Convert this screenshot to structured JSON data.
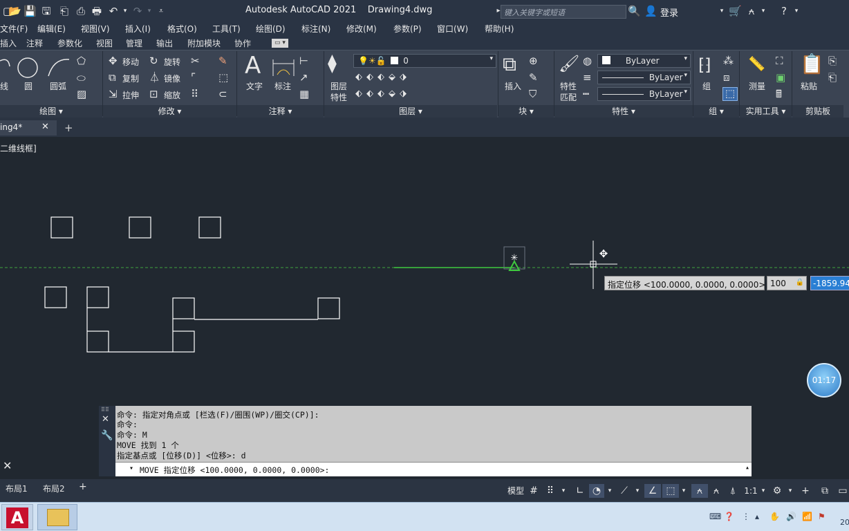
{
  "titlebar": {
    "app_title": "Autodesk AutoCAD 2021    Drawing4.dwg",
    "search_placeholder": "键入关键字或短语",
    "login": "登录"
  },
  "menu": [
    "文件(F)",
    "编辑(E)",
    "视图(V)",
    "插入(I)",
    "格式(O)",
    "工具(T)",
    "绘图(D)",
    "标注(N)",
    "修改(M)",
    "参数(P)",
    "窗口(W)",
    "帮助(H)"
  ],
  "ribbon_tabs": [
    "插入",
    "注释",
    "参数化",
    "视图",
    "管理",
    "输出",
    "附加模块",
    "协作"
  ],
  "ribbon": {
    "draw": {
      "line": "线",
      "circle": "圆",
      "arc": "圆弧",
      "title": "绘图"
    },
    "modify": {
      "move": "移动",
      "rotate": "旋转",
      "copy": "复制",
      "mirror": "镜像",
      "stretch": "拉伸",
      "scale": "缩放",
      "title": "修改"
    },
    "annotation": {
      "text": "文字",
      "dimension": "标注",
      "title": "注释"
    },
    "layers": {
      "properties_1": "图层",
      "properties_2": "特性",
      "current_layer": "0",
      "title": "图层"
    },
    "block": {
      "insert": "插入",
      "title": "块"
    },
    "properties": {
      "match_1": "特性",
      "match_2": "匹配",
      "color": "ByLayer",
      "linetype": "ByLayer",
      "lineweight": "ByLayer",
      "title": "特性"
    },
    "groups": {
      "group": "组",
      "title": "组"
    },
    "utilities": {
      "measure": "测量",
      "title": "实用工具"
    },
    "clipboard": {
      "paste": "粘贴",
      "title": "剪贴板"
    }
  },
  "doc_tab": {
    "name": "ing4*"
  },
  "viewport_label": "二维线框]",
  "dynamic_input": {
    "prompt": "指定位移 <100.0000, 0.0000, 0.0000>:",
    "field1": "100",
    "field2": "-1859.949"
  },
  "timer": "01:17",
  "command_history": [
    "命令: 指定对角点或 [栏选(F)/圈围(WP)/圈交(CP)]:",
    "命令:",
    "命令: M",
    "MOVE 找到 1 个",
    "指定基点或 [位移(D)] <位移>:  d"
  ],
  "command_input": "MOVE 指定位移 <100.0000, 0.0000, 0.0000>:",
  "layout_tabs": [
    "布局1",
    "布局2"
  ],
  "status": {
    "model": "模型",
    "scale": "1:1"
  },
  "taskbar": {
    "clock_fragment": "20"
  }
}
